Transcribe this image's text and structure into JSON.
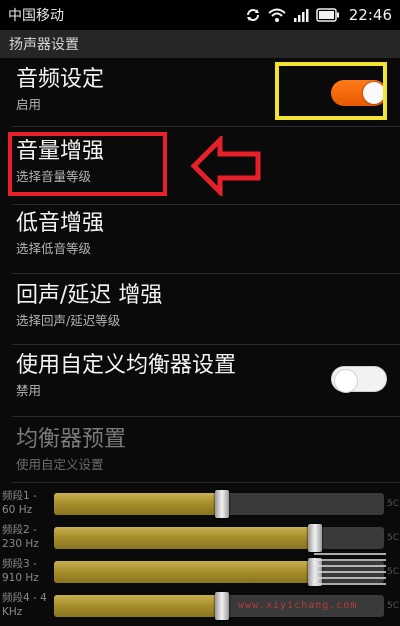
{
  "status_bar": {
    "carrier": "中国移动",
    "time": "22:46"
  },
  "section_header": "扬声器设置",
  "settings": [
    {
      "title": "音频设定",
      "subtitle": "启用",
      "toggle": "on"
    },
    {
      "title": "音量增强",
      "subtitle": "选择音量等级"
    },
    {
      "title": "低音增强",
      "subtitle": "选择低音等级"
    },
    {
      "title": "回声/延迟 增强",
      "subtitle": "选择回声/延迟等级"
    },
    {
      "title": "使用自定义均衡器设置",
      "subtitle": "禁用",
      "toggle": "off"
    },
    {
      "title": "均衡器预置",
      "subtitle": "使用自定义设置",
      "disabled": true
    }
  ],
  "equalizer": {
    "bands": [
      {
        "label_line1": "频段1 -",
        "label_line2": "60 Hz",
        "level": 0.51
      },
      {
        "label_line1": "频段2 -",
        "label_line2": "230 Hz",
        "level": 0.79
      },
      {
        "label_line1": "频段3 -",
        "label_line2": "910 Hz",
        "level": 0.79
      },
      {
        "label_line1": "频段4 - 4",
        "label_line2": "KHz",
        "level": 0.51
      }
    ],
    "end_label": "5C"
  },
  "watermark": "www.xiyichang.com",
  "colors": {
    "toggle_on": "#ff7a1a",
    "highlight_yellow": "#f2e430",
    "highlight_red": "#e8202a",
    "eq_fill": "#a48c2a"
  },
  "icons": [
    "sync-icon",
    "wifi-icon",
    "signal-icon",
    "battery-icon"
  ]
}
